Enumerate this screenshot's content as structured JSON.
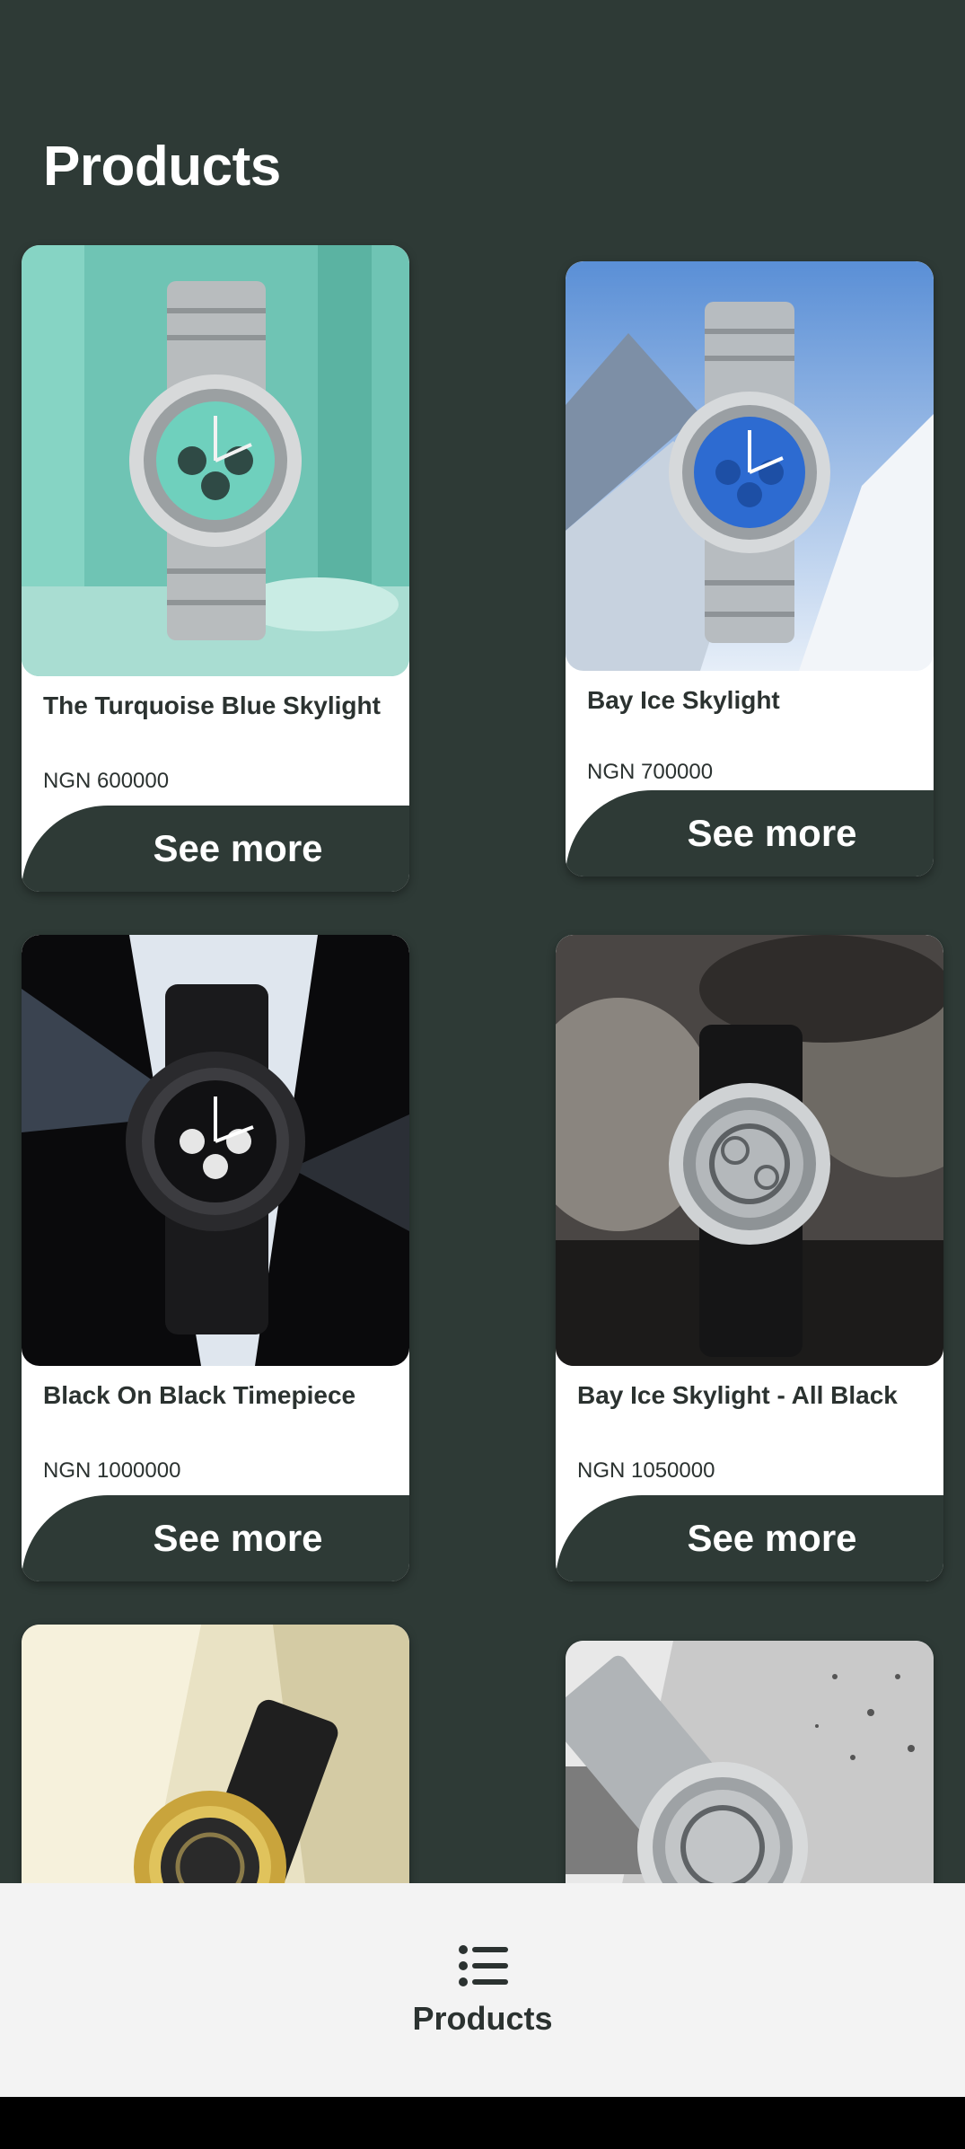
{
  "header": {
    "title": "Products"
  },
  "products": [
    {
      "name": "The Turquoise Blue Skylight",
      "price": "NGN 600000",
      "cta": "See more",
      "image": "turquoise-dial-steel-watch"
    },
    {
      "name": "Bay Ice Skylight",
      "price": "NGN 700000",
      "cta": "See more",
      "image": "blue-dial-steel-watch-snow"
    },
    {
      "name": "Black On Black Timepiece",
      "price": "NGN 1000000",
      "cta": "See more",
      "image": "black-iced-watch"
    },
    {
      "name": "Bay Ice Skylight - All Black",
      "price": "NGN 1050000",
      "cta": "See more",
      "image": "skeleton-steel-watch-rocks"
    },
    {
      "name": "",
      "price": "",
      "cta": "",
      "image": "gold-skeleton-watch"
    },
    {
      "name": "",
      "price": "",
      "cta": "",
      "image": "steel-skeleton-watch-grey"
    }
  ],
  "bottom_nav": {
    "items": [
      {
        "label": "Products",
        "icon": "list-icon"
      }
    ]
  },
  "colors": {
    "background": "#2e3a36",
    "card": "#ffffff",
    "nav": "#f3f3f3",
    "text": "#2b3230"
  }
}
